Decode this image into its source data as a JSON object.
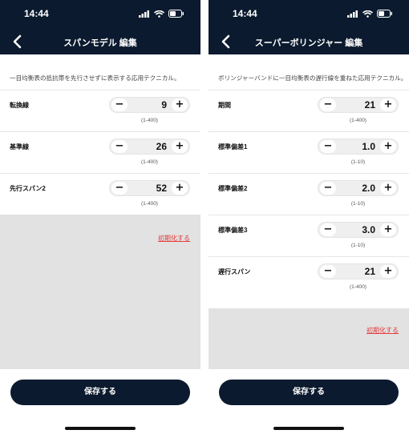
{
  "status_bar": {
    "time": "14:44"
  },
  "screens": [
    {
      "title": "スパンモデル 編集",
      "description": "一目均衡表の抵抗帯を先行させずに表示する応用テクニカル。",
      "fields": [
        {
          "label": "転換線",
          "value": "9",
          "range": "(1-400)"
        },
        {
          "label": "基準線",
          "value": "26",
          "range": "(1-400)"
        },
        {
          "label": "先行スパン2",
          "value": "52",
          "range": "(1-400)"
        }
      ],
      "reset_label": "初期化する",
      "save_label": "保存する"
    },
    {
      "title": "スーパーボリンジャー 編集",
      "description": "ボリンジャーバンドに一目均衡表の遅行線を重ねた応用テクニカル。",
      "fields": [
        {
          "label": "期間",
          "value": "21",
          "range": "(1-400)"
        },
        {
          "label": "標準偏差1",
          "value": "1.0",
          "range": "(1-10)"
        },
        {
          "label": "標準偏差2",
          "value": "2.0",
          "range": "(1-10)"
        },
        {
          "label": "標準偏差3",
          "value": "3.0",
          "range": "(1-10)"
        },
        {
          "label": "遅行スパン",
          "value": "21",
          "range": "(1-400)"
        }
      ],
      "reset_label": "初期化する",
      "save_label": "保存する"
    }
  ],
  "stepper": {
    "minus": "−",
    "plus": "+"
  },
  "colors": {
    "header": "#0b1a2e",
    "reset": "#e43b3b",
    "panel": "#e2e2e2"
  }
}
